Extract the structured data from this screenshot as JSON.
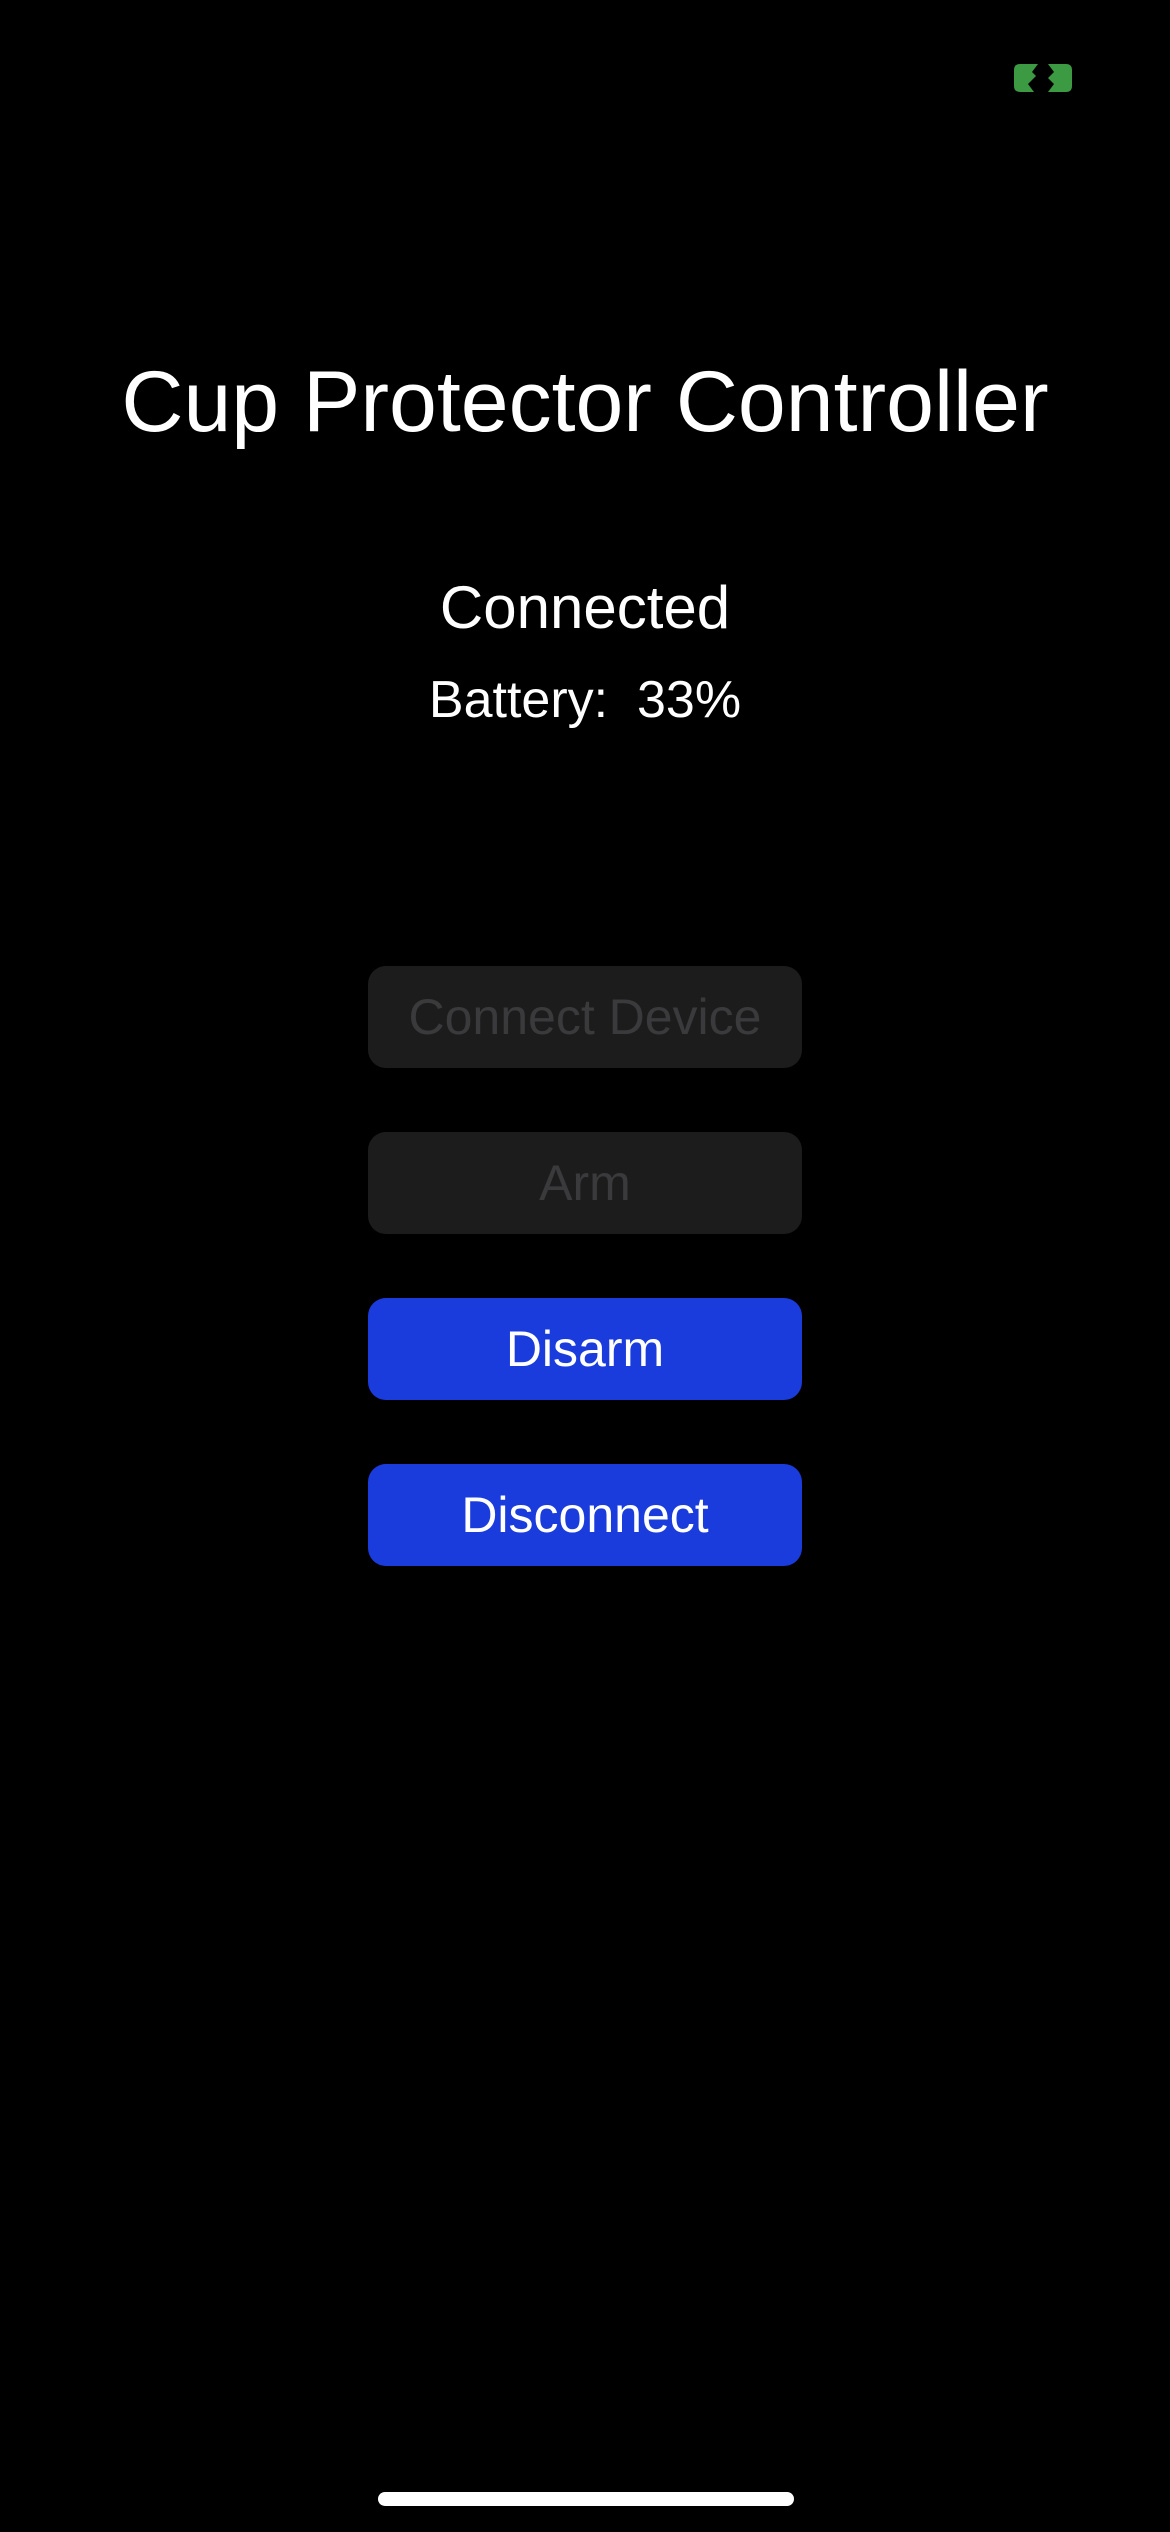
{
  "app": {
    "title": "Cup Protector Controller"
  },
  "status": {
    "connection": "Connected",
    "battery_label": "Battery:",
    "battery_value": "33%",
    "indicator_icon": "link-status-icon",
    "indicator_color": "#3c9a42"
  },
  "buttons": {
    "connect_device": {
      "label": "Connect Device",
      "enabled": false
    },
    "arm": {
      "label": "Arm",
      "enabled": false
    },
    "disarm": {
      "label": "Disarm",
      "enabled": true
    },
    "disconnect": {
      "label": "Disconnect",
      "enabled": true
    }
  },
  "colors": {
    "background": "#000000",
    "button_active": "#1a3cdc",
    "button_disabled_bg": "#1c1c1c",
    "button_disabled_text": "#3a3a3c"
  }
}
